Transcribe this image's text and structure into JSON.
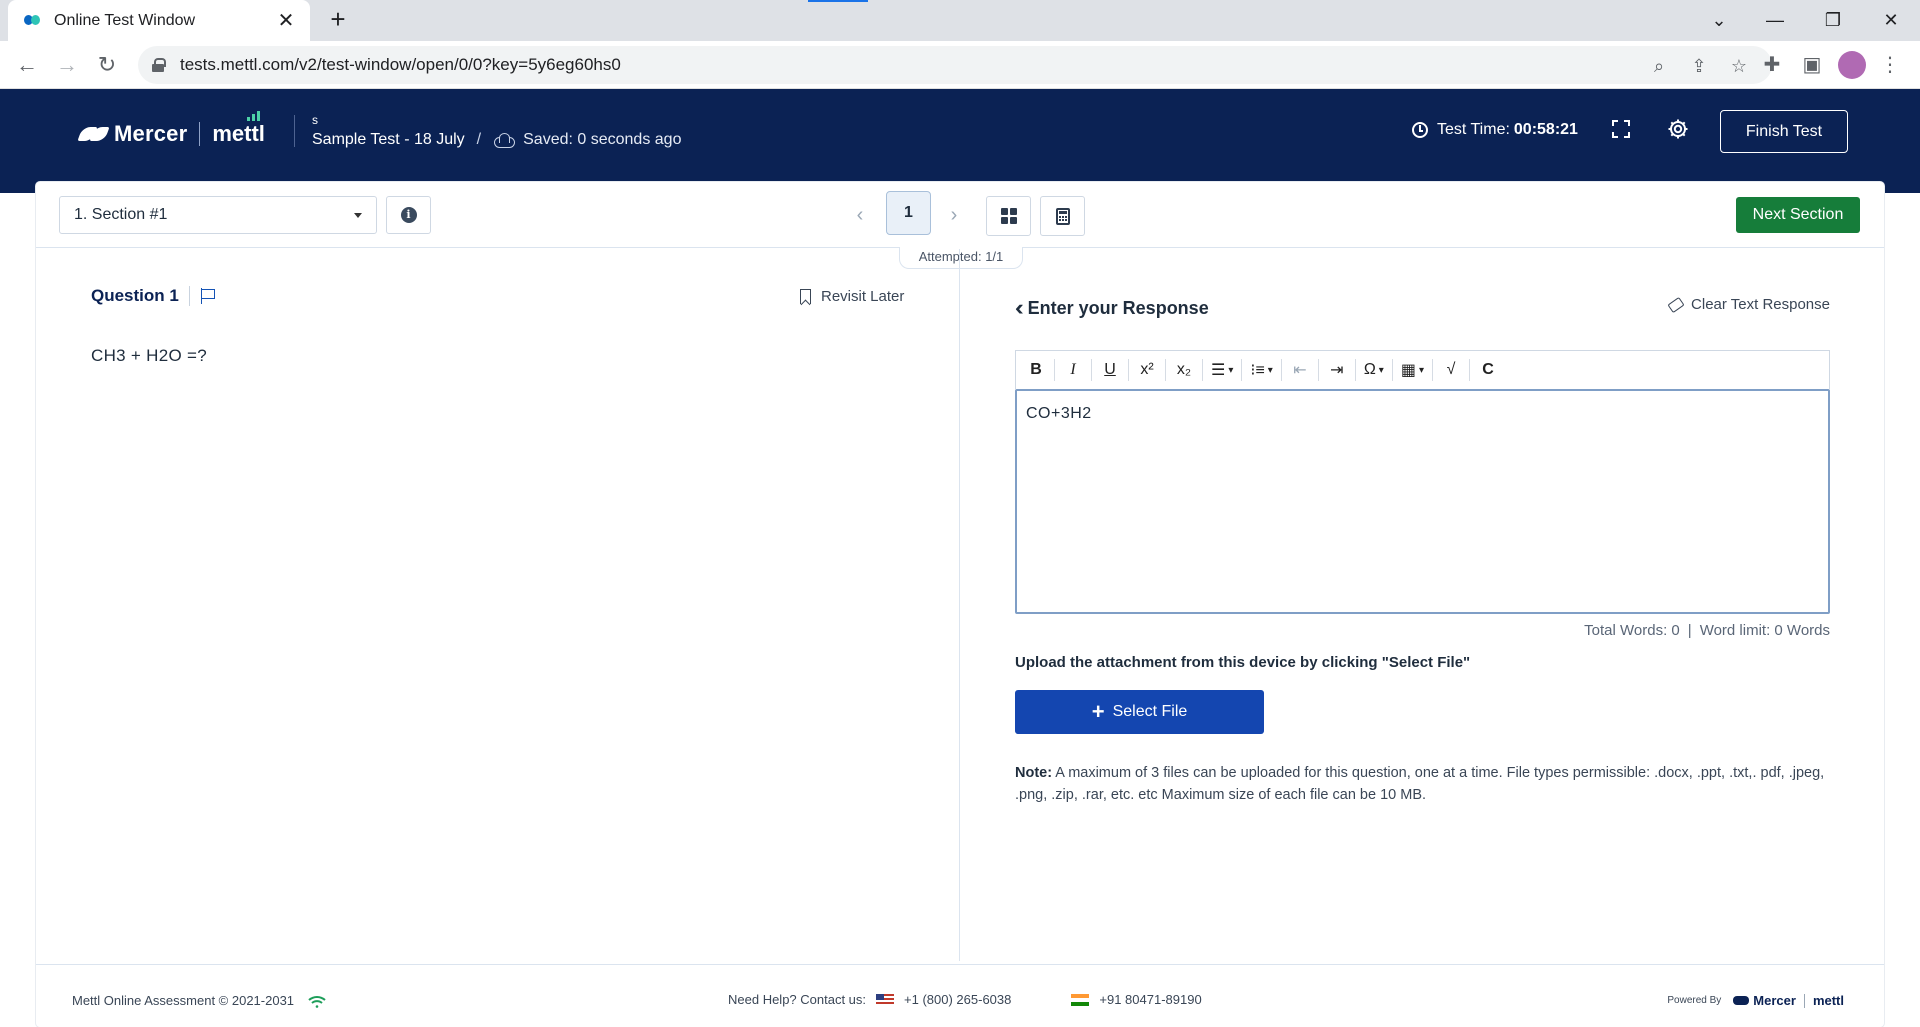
{
  "browser": {
    "tab_title": "Online Test Window",
    "tab_close": "✕",
    "new_tab": "+",
    "url": "tests.mettl.com/v2/test-window/open/0/0?key=5y6eg60hs0"
  },
  "header": {
    "brand_left": "Mercer",
    "brand_right": "mettl",
    "user": "s",
    "test_name": "Sample Test - 18 July",
    "separator": "/",
    "saved_status": "Saved: 0 seconds ago",
    "timer_label": "Test Time:",
    "timer_value": "00:58:21",
    "finish_label": "Finish Test"
  },
  "toolbar": {
    "section_label": "1. Section #1",
    "current_page": "1",
    "prev_arrow": "‹",
    "next_arrow": "›",
    "next_section_label": "Next Section",
    "attempted": "Attempted: 1/1"
  },
  "question": {
    "title": "Question 1",
    "revisit_label": "Revisit Later",
    "text": "CH3 + H2O =?"
  },
  "response": {
    "title": "Enter your Response",
    "clear_label": "Clear Text Response",
    "editor_value": "CO+3H2",
    "total_words": "Total Words: 0",
    "word_limit": "Word limit: 0 Words",
    "pipe": "|",
    "upload_text": "Upload the attachment from this device by clicking \"Select File\"",
    "select_file_label": "Select File",
    "note_label": "Note:",
    "note_text": "A maximum of 3 files can be uploaded for this question, one at a time. File types permissible: .docx, .ppt, .txt,. pdf, .jpeg, .png, .zip, .rar, etc. etc Maximum size of each file can be 10 MB."
  },
  "editor_toolbar": {
    "bold": "B",
    "italic": "I",
    "underline": "U",
    "superscript": "x²",
    "subscript": "x₂",
    "special_char": "Ω"
  },
  "footer": {
    "copyright": "Mettl Online Assessment © 2021-2031",
    "help_label": "Need Help? Contact us:",
    "us_phone": "+1 (800) 265-6038",
    "in_phone": "+91 80471-89190",
    "powered_by": "Powered By",
    "brand_left": "Mercer",
    "brand_right": "mettl"
  },
  "colors": {
    "header_bg": "#0b2254",
    "next_section_bg": "#167d3a",
    "select_file_bg": "#1446b0",
    "accent_text": "#0b2254"
  },
  "icons": [
    "search-icon",
    "share-icon",
    "star-icon",
    "extensions-icon",
    "sidebar-icon",
    "clock-icon",
    "fullscreen-icon",
    "gear-icon",
    "info-icon",
    "grid-icon",
    "calculator-icon",
    "flag-icon",
    "bookmark-icon",
    "eraser-icon",
    "wifi-icon"
  ]
}
